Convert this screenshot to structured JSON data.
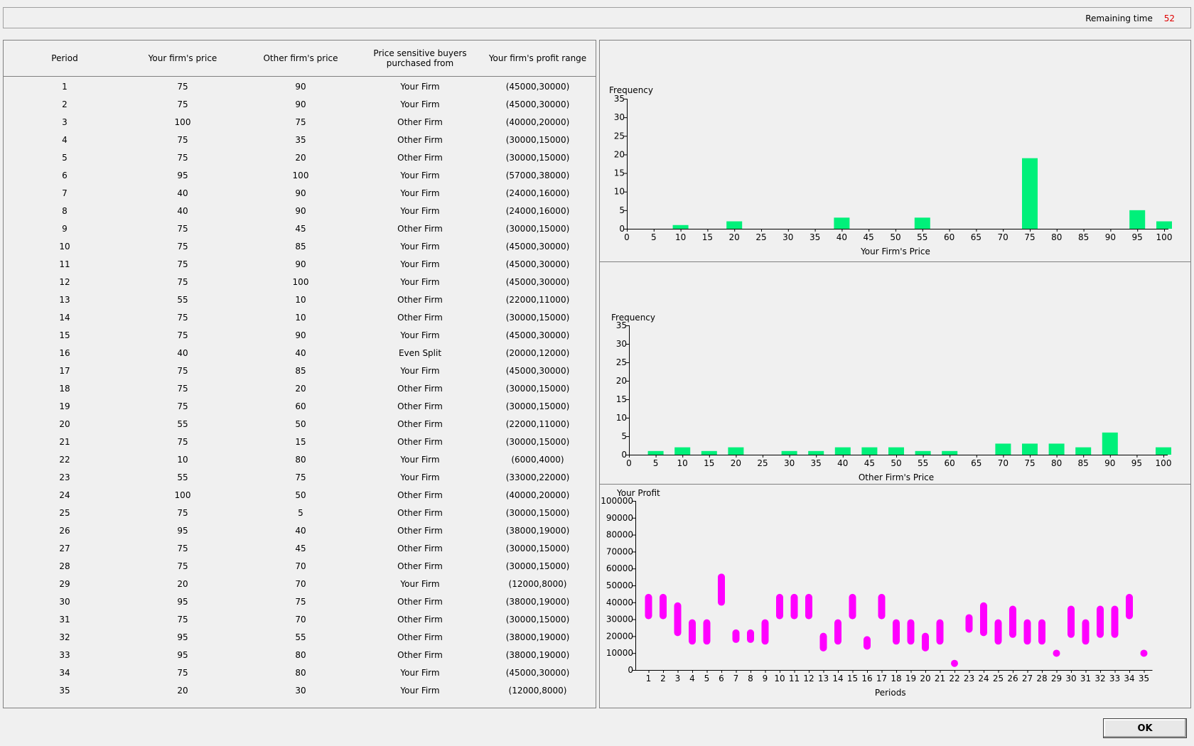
{
  "header": {
    "remaining_label": "Remaining time",
    "remaining_value": "52"
  },
  "table": {
    "columns": [
      "Period",
      "Your firm's price",
      "Other firm's price",
      "Price sensitive buyers purchased from",
      "Your firm's profit range"
    ],
    "rows": [
      [
        "1",
        "75",
        "90",
        "Your Firm",
        "(45000,30000)"
      ],
      [
        "2",
        "75",
        "90",
        "Your Firm",
        "(45000,30000)"
      ],
      [
        "3",
        "100",
        "75",
        "Other Firm",
        "(40000,20000)"
      ],
      [
        "4",
        "75",
        "35",
        "Other Firm",
        "(30000,15000)"
      ],
      [
        "5",
        "75",
        "20",
        "Other Firm",
        "(30000,15000)"
      ],
      [
        "6",
        "95",
        "100",
        "Your Firm",
        "(57000,38000)"
      ],
      [
        "7",
        "40",
        "90",
        "Your Firm",
        "(24000,16000)"
      ],
      [
        "8",
        "40",
        "90",
        "Your Firm",
        "(24000,16000)"
      ],
      [
        "9",
        "75",
        "45",
        "Other Firm",
        "(30000,15000)"
      ],
      [
        "10",
        "75",
        "85",
        "Your Firm",
        "(45000,30000)"
      ],
      [
        "11",
        "75",
        "90",
        "Your Firm",
        "(45000,30000)"
      ],
      [
        "12",
        "75",
        "100",
        "Your Firm",
        "(45000,30000)"
      ],
      [
        "13",
        "55",
        "10",
        "Other Firm",
        "(22000,11000)"
      ],
      [
        "14",
        "75",
        "10",
        "Other Firm",
        "(30000,15000)"
      ],
      [
        "15",
        "75",
        "90",
        "Your Firm",
        "(45000,30000)"
      ],
      [
        "16",
        "40",
        "40",
        "Even Split",
        "(20000,12000)"
      ],
      [
        "17",
        "75",
        "85",
        "Your Firm",
        "(45000,30000)"
      ],
      [
        "18",
        "75",
        "20",
        "Other Firm",
        "(30000,15000)"
      ],
      [
        "19",
        "75",
        "60",
        "Other Firm",
        "(30000,15000)"
      ],
      [
        "20",
        "55",
        "50",
        "Other Firm",
        "(22000,11000)"
      ],
      [
        "21",
        "75",
        "15",
        "Other Firm",
        "(30000,15000)"
      ],
      [
        "22",
        "10",
        "80",
        "Your Firm",
        "(6000,4000)"
      ],
      [
        "23",
        "55",
        "75",
        "Your Firm",
        "(33000,22000)"
      ],
      [
        "24",
        "100",
        "50",
        "Other Firm",
        "(40000,20000)"
      ],
      [
        "25",
        "75",
        "5",
        "Other Firm",
        "(30000,15000)"
      ],
      [
        "26",
        "95",
        "40",
        "Other Firm",
        "(38000,19000)"
      ],
      [
        "27",
        "75",
        "45",
        "Other Firm",
        "(30000,15000)"
      ],
      [
        "28",
        "75",
        "70",
        "Other Firm",
        "(30000,15000)"
      ],
      [
        "29",
        "20",
        "70",
        "Your Firm",
        "(12000,8000)"
      ],
      [
        "30",
        "95",
        "75",
        "Other Firm",
        "(38000,19000)"
      ],
      [
        "31",
        "75",
        "70",
        "Other Firm",
        "(30000,15000)"
      ],
      [
        "32",
        "95",
        "55",
        "Other Firm",
        "(38000,19000)"
      ],
      [
        "33",
        "95",
        "80",
        "Other Firm",
        "(38000,19000)"
      ],
      [
        "34",
        "75",
        "80",
        "Your Firm",
        "(45000,30000)"
      ],
      [
        "35",
        "20",
        "30",
        "Your Firm",
        "(12000,8000)"
      ]
    ]
  },
  "colors": {
    "histogram_bar": "#00f07a",
    "profit_bar": "#ff00ff",
    "remaining_value": "#e00000"
  },
  "chart_data": [
    {
      "type": "bar",
      "ylabel": "Frequency",
      "xlabel": "Your Firm's Price",
      "categories": [
        "5",
        "10",
        "15",
        "20",
        "25",
        "30",
        "35",
        "40",
        "45",
        "50",
        "55",
        "60",
        "65",
        "70",
        "75",
        "80",
        "85",
        "90",
        "95",
        "100"
      ],
      "values": [
        0,
        1,
        0,
        2,
        0,
        0,
        0,
        3,
        0,
        0,
        3,
        0,
        0,
        0,
        19,
        0,
        0,
        0,
        5,
        2
      ],
      "xticks": [
        "0",
        "5",
        "10",
        "15",
        "20",
        "25",
        "30",
        "35",
        "40",
        "45",
        "50",
        "55",
        "60",
        "65",
        "70",
        "75",
        "80",
        "85",
        "90",
        "95",
        "100"
      ],
      "yticks": [
        "0",
        "5",
        "10",
        "15",
        "20",
        "25",
        "30",
        "35"
      ],
      "ylim": [
        0,
        35
      ]
    },
    {
      "type": "bar",
      "ylabel": "Frequency",
      "xlabel": "Other Firm's Price",
      "categories": [
        "5",
        "10",
        "15",
        "20",
        "25",
        "30",
        "35",
        "40",
        "45",
        "50",
        "55",
        "60",
        "65",
        "70",
        "75",
        "80",
        "85",
        "90",
        "95",
        "100"
      ],
      "values": [
        1,
        2,
        1,
        2,
        0,
        1,
        1,
        2,
        2,
        2,
        1,
        1,
        0,
        3,
        3,
        3,
        2,
        6,
        0,
        2
      ],
      "xticks": [
        "0",
        "5",
        "10",
        "15",
        "20",
        "25",
        "30",
        "35",
        "40",
        "45",
        "50",
        "55",
        "60",
        "65",
        "70",
        "75",
        "80",
        "85",
        "90",
        "95",
        "100"
      ],
      "yticks": [
        "0",
        "5",
        "10",
        "15",
        "20",
        "25",
        "30",
        "35"
      ],
      "ylim": [
        0,
        35
      ]
    },
    {
      "type": "bar",
      "ylabel": "Your Profit",
      "xlabel": "Periods",
      "categories": [
        "1",
        "2",
        "3",
        "4",
        "5",
        "6",
        "7",
        "8",
        "9",
        "10",
        "11",
        "12",
        "13",
        "14",
        "15",
        "16",
        "17",
        "18",
        "19",
        "20",
        "21",
        "22",
        "23",
        "24",
        "25",
        "26",
        "27",
        "28",
        "29",
        "30",
        "31",
        "32",
        "33",
        "34",
        "35"
      ],
      "ranges": [
        [
          45000,
          30000
        ],
        [
          45000,
          30000
        ],
        [
          40000,
          20000
        ],
        [
          30000,
          15000
        ],
        [
          30000,
          15000
        ],
        [
          57000,
          38000
        ],
        [
          24000,
          16000
        ],
        [
          24000,
          16000
        ],
        [
          30000,
          15000
        ],
        [
          45000,
          30000
        ],
        [
          45000,
          30000
        ],
        [
          45000,
          30000
        ],
        [
          22000,
          11000
        ],
        [
          30000,
          15000
        ],
        [
          45000,
          30000
        ],
        [
          20000,
          12000
        ],
        [
          45000,
          30000
        ],
        [
          30000,
          15000
        ],
        [
          30000,
          15000
        ],
        [
          22000,
          11000
        ],
        [
          30000,
          15000
        ],
        [
          6000,
          4000
        ],
        [
          33000,
          22000
        ],
        [
          40000,
          20000
        ],
        [
          30000,
          15000
        ],
        [
          38000,
          19000
        ],
        [
          30000,
          15000
        ],
        [
          30000,
          15000
        ],
        [
          12000,
          8000
        ],
        [
          38000,
          19000
        ],
        [
          30000,
          15000
        ],
        [
          38000,
          19000
        ],
        [
          38000,
          19000
        ],
        [
          45000,
          30000
        ],
        [
          12000,
          8000
        ]
      ],
      "yticks": [
        "0",
        "10000",
        "20000",
        "30000",
        "40000",
        "50000",
        "60000",
        "70000",
        "80000",
        "90000",
        "100000"
      ],
      "ylim": [
        0,
        100000
      ]
    }
  ],
  "footer": {
    "ok_label": "OK"
  }
}
